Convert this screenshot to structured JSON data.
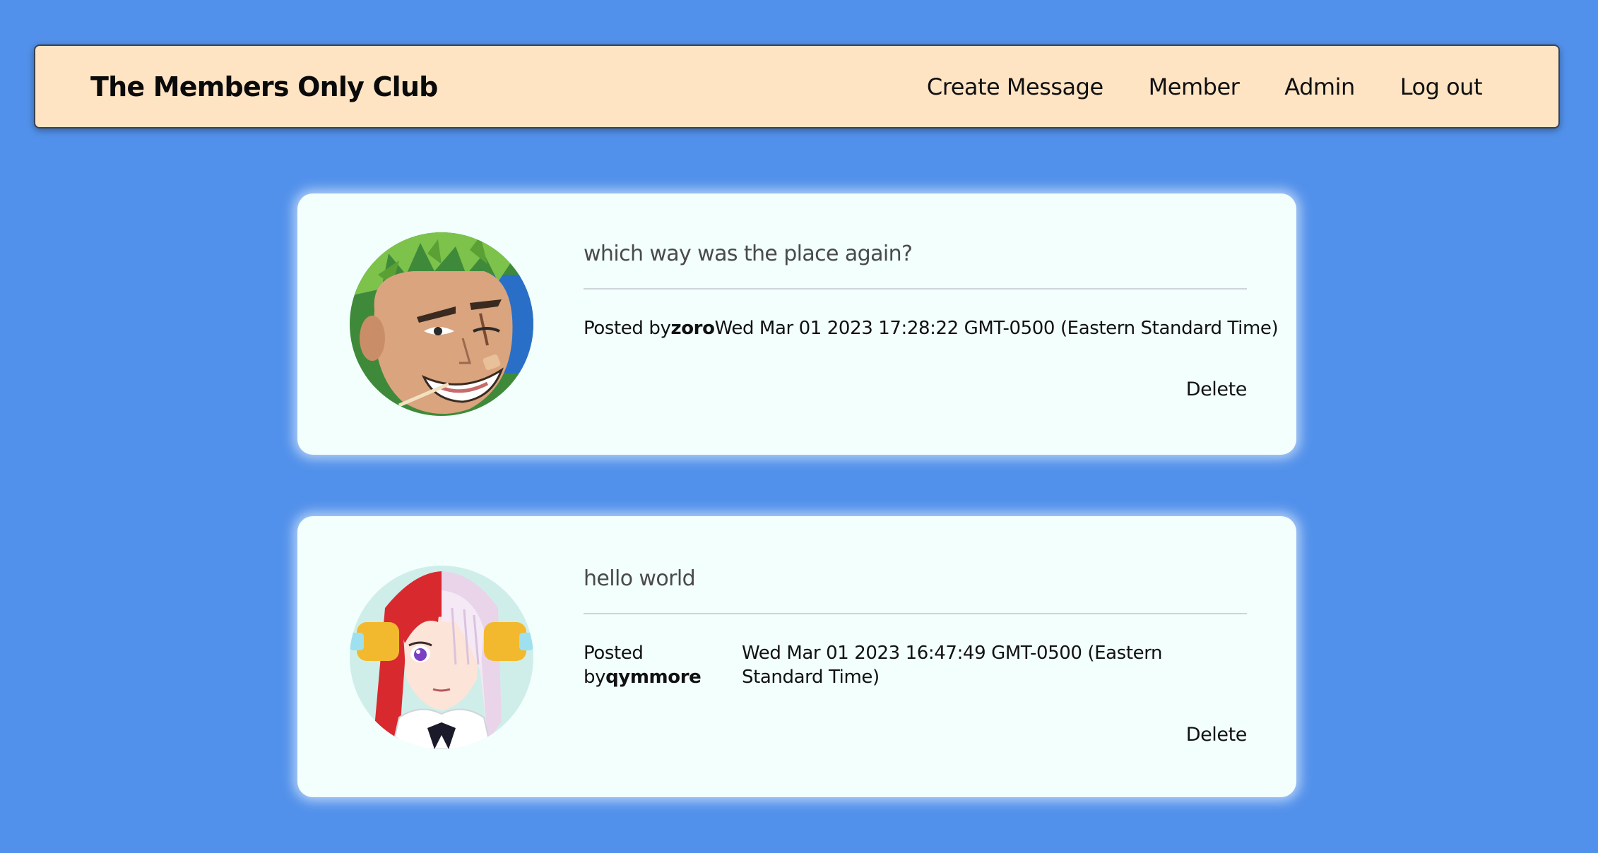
{
  "nav": {
    "brand": "The Members Only Club",
    "links": [
      "Create Message",
      "Member",
      "Admin",
      "Log out"
    ]
  },
  "messages": [
    {
      "text": "which way was the place again?",
      "posted_prefix": "Posted by",
      "author": "zoro",
      "date": "Wed Mar 01 2023 17:28:22 GMT-0500 (Eastern Standard Time)",
      "delete_label": "Delete",
      "avatar": "green-haired-swordsman-avatar"
    },
    {
      "text": "hello world",
      "posted_prefix": "Posted by",
      "author": "qymmore",
      "date": "Wed Mar 01 2023 16:47:49 GMT-0500 (Eastern Standard Time)",
      "delete_label": "Delete",
      "avatar": "red-white-haired-singer-avatar"
    }
  ],
  "colors": {
    "page_background": "#5291eb",
    "navbar_background": "#ffe4c4",
    "card_background": "#f2fffd"
  }
}
